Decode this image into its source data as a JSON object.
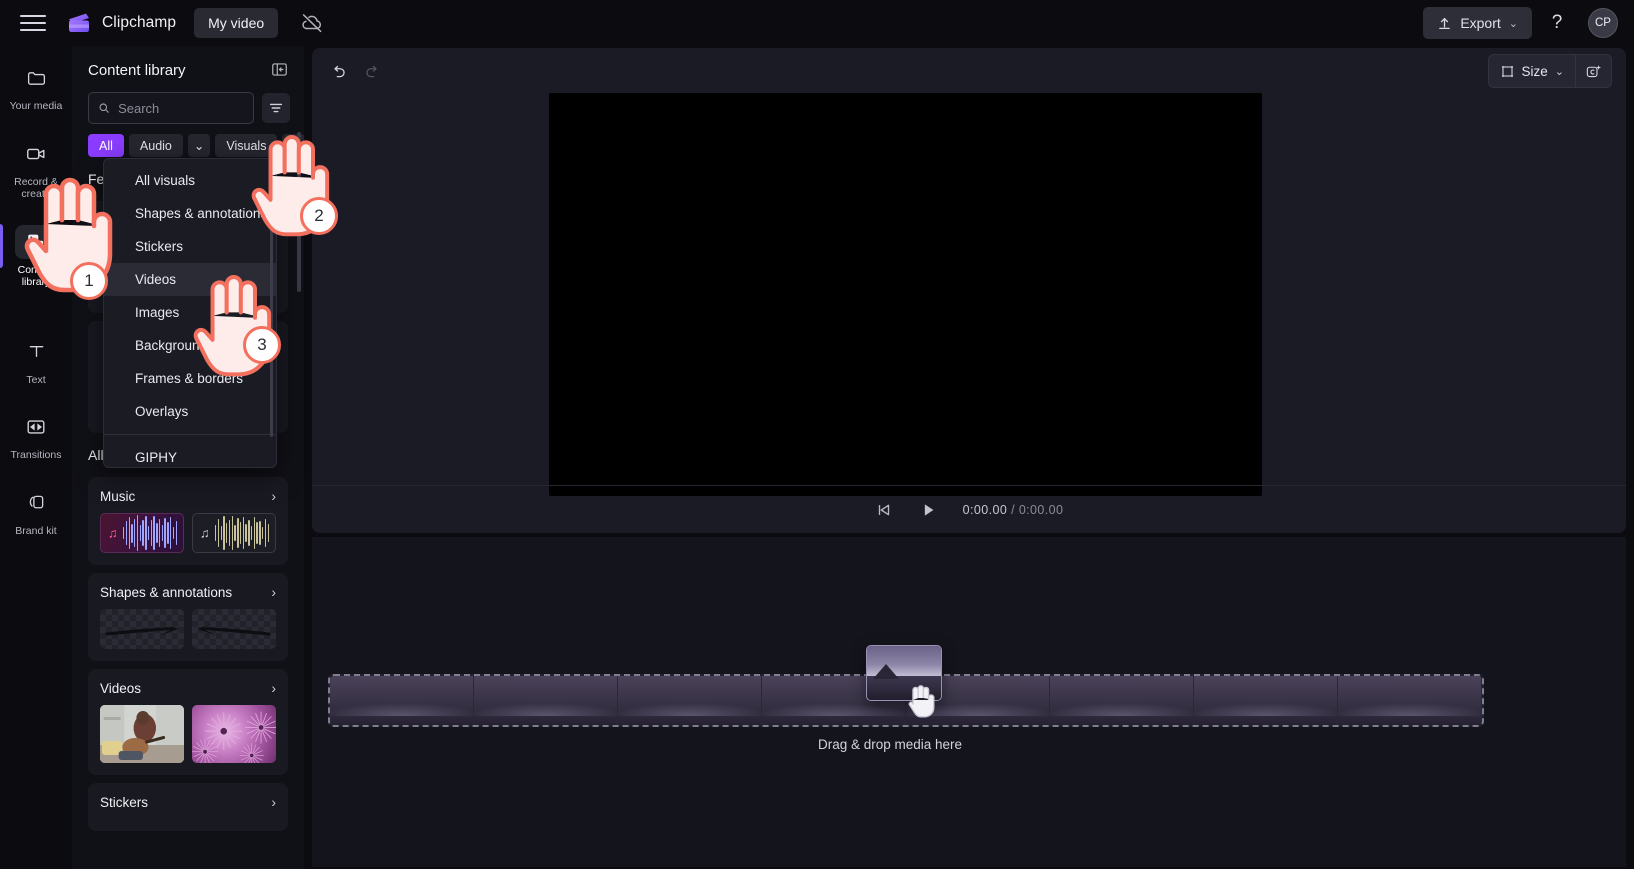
{
  "header": {
    "menu_icon": "hamburger-icon",
    "brand": "Clipchamp",
    "project_name": "My video",
    "cloud_status_icon": "cloud-off-icon",
    "export_label": "Export",
    "export_icon": "upload-icon",
    "export_caret": "⌄",
    "help_label": "?",
    "avatar_initials": "CP"
  },
  "rail": {
    "items": [
      {
        "label": "Your media",
        "icon": "folder-icon",
        "active": false
      },
      {
        "label": "Record & create",
        "icon": "video-camera-icon",
        "active": false
      },
      {
        "label": "Content library",
        "icon": "content-library-icon",
        "active": true
      },
      {
        "label": "Text",
        "icon": "text-icon",
        "active": false
      },
      {
        "label": "Transitions",
        "icon": "transitions-icon",
        "active": false
      },
      {
        "label": "Brand kit",
        "icon": "brand-kit-icon",
        "active": false
      }
    ]
  },
  "panel": {
    "title": "Content library",
    "collapse_icon": "collapse-panel-icon",
    "search": {
      "placeholder": "Search",
      "value": "",
      "icon": "search-icon"
    },
    "filter_icon": "filter-icon",
    "chips": [
      {
        "label": "All",
        "accent": true
      },
      {
        "label": "Audio",
        "accent": false
      },
      {
        "label": "⌄",
        "accent": false,
        "caret": true
      },
      {
        "label": "Visuals",
        "accent": false
      },
      {
        "label": "⌄",
        "accent": false,
        "caret": true
      }
    ],
    "featured_heading": "Featured",
    "all_heading": "All",
    "cards": [
      {
        "title": "Music",
        "chevron": "›",
        "kind": "audio"
      },
      {
        "title": "Shapes & annotations",
        "chevron": "›",
        "kind": "shapes"
      },
      {
        "title": "Videos",
        "chevron": "›",
        "kind": "videos"
      },
      {
        "title": "Stickers",
        "chevron": "›",
        "kind": "stickers"
      }
    ]
  },
  "dropdown": {
    "items": [
      {
        "label": "All visuals",
        "highlighted": false
      },
      {
        "label": "Shapes & annotations",
        "highlighted": false
      },
      {
        "label": "Stickers",
        "highlighted": false
      },
      {
        "label": "Videos",
        "highlighted": true
      },
      {
        "label": "Images",
        "highlighted": false
      },
      {
        "label": "Backgrounds",
        "highlighted": false
      },
      {
        "label": "Frames & borders",
        "highlighted": false
      },
      {
        "label": "Overlays",
        "highlighted": false
      }
    ],
    "footer_item": "GIPHY"
  },
  "stage": {
    "undo_icon": "undo-icon",
    "redo_icon": "redo-icon",
    "size_label": "Size",
    "size_icon": "crop-frame-icon",
    "size_caret": "⌄",
    "ai_icon": "ai-sparkle-icon",
    "skip_start_icon": "skip-to-start-icon",
    "play_icon": "play-icon",
    "current_time": "0:00.00",
    "time_separator": "/",
    "total_time": "0:00.00"
  },
  "timeline": {
    "drop_label": "Drag & drop media here",
    "frame_count": 8,
    "drag_cursor_icon": "grab-hand-icon"
  },
  "annotations": [
    {
      "number": "1",
      "target": "content-library-rail-item"
    },
    {
      "number": "2",
      "target": "visuals-dropdown-caret"
    },
    {
      "number": "3",
      "target": "videos-menu-item"
    }
  ],
  "colors": {
    "accent_purple": "#8b3dff",
    "rail_active_bar": "#7a5cf0",
    "annotation_outline": "#f4705e",
    "panel_bg": "#101017",
    "stage_bg": "#1b1b25",
    "timeline_bg": "#14141c"
  }
}
